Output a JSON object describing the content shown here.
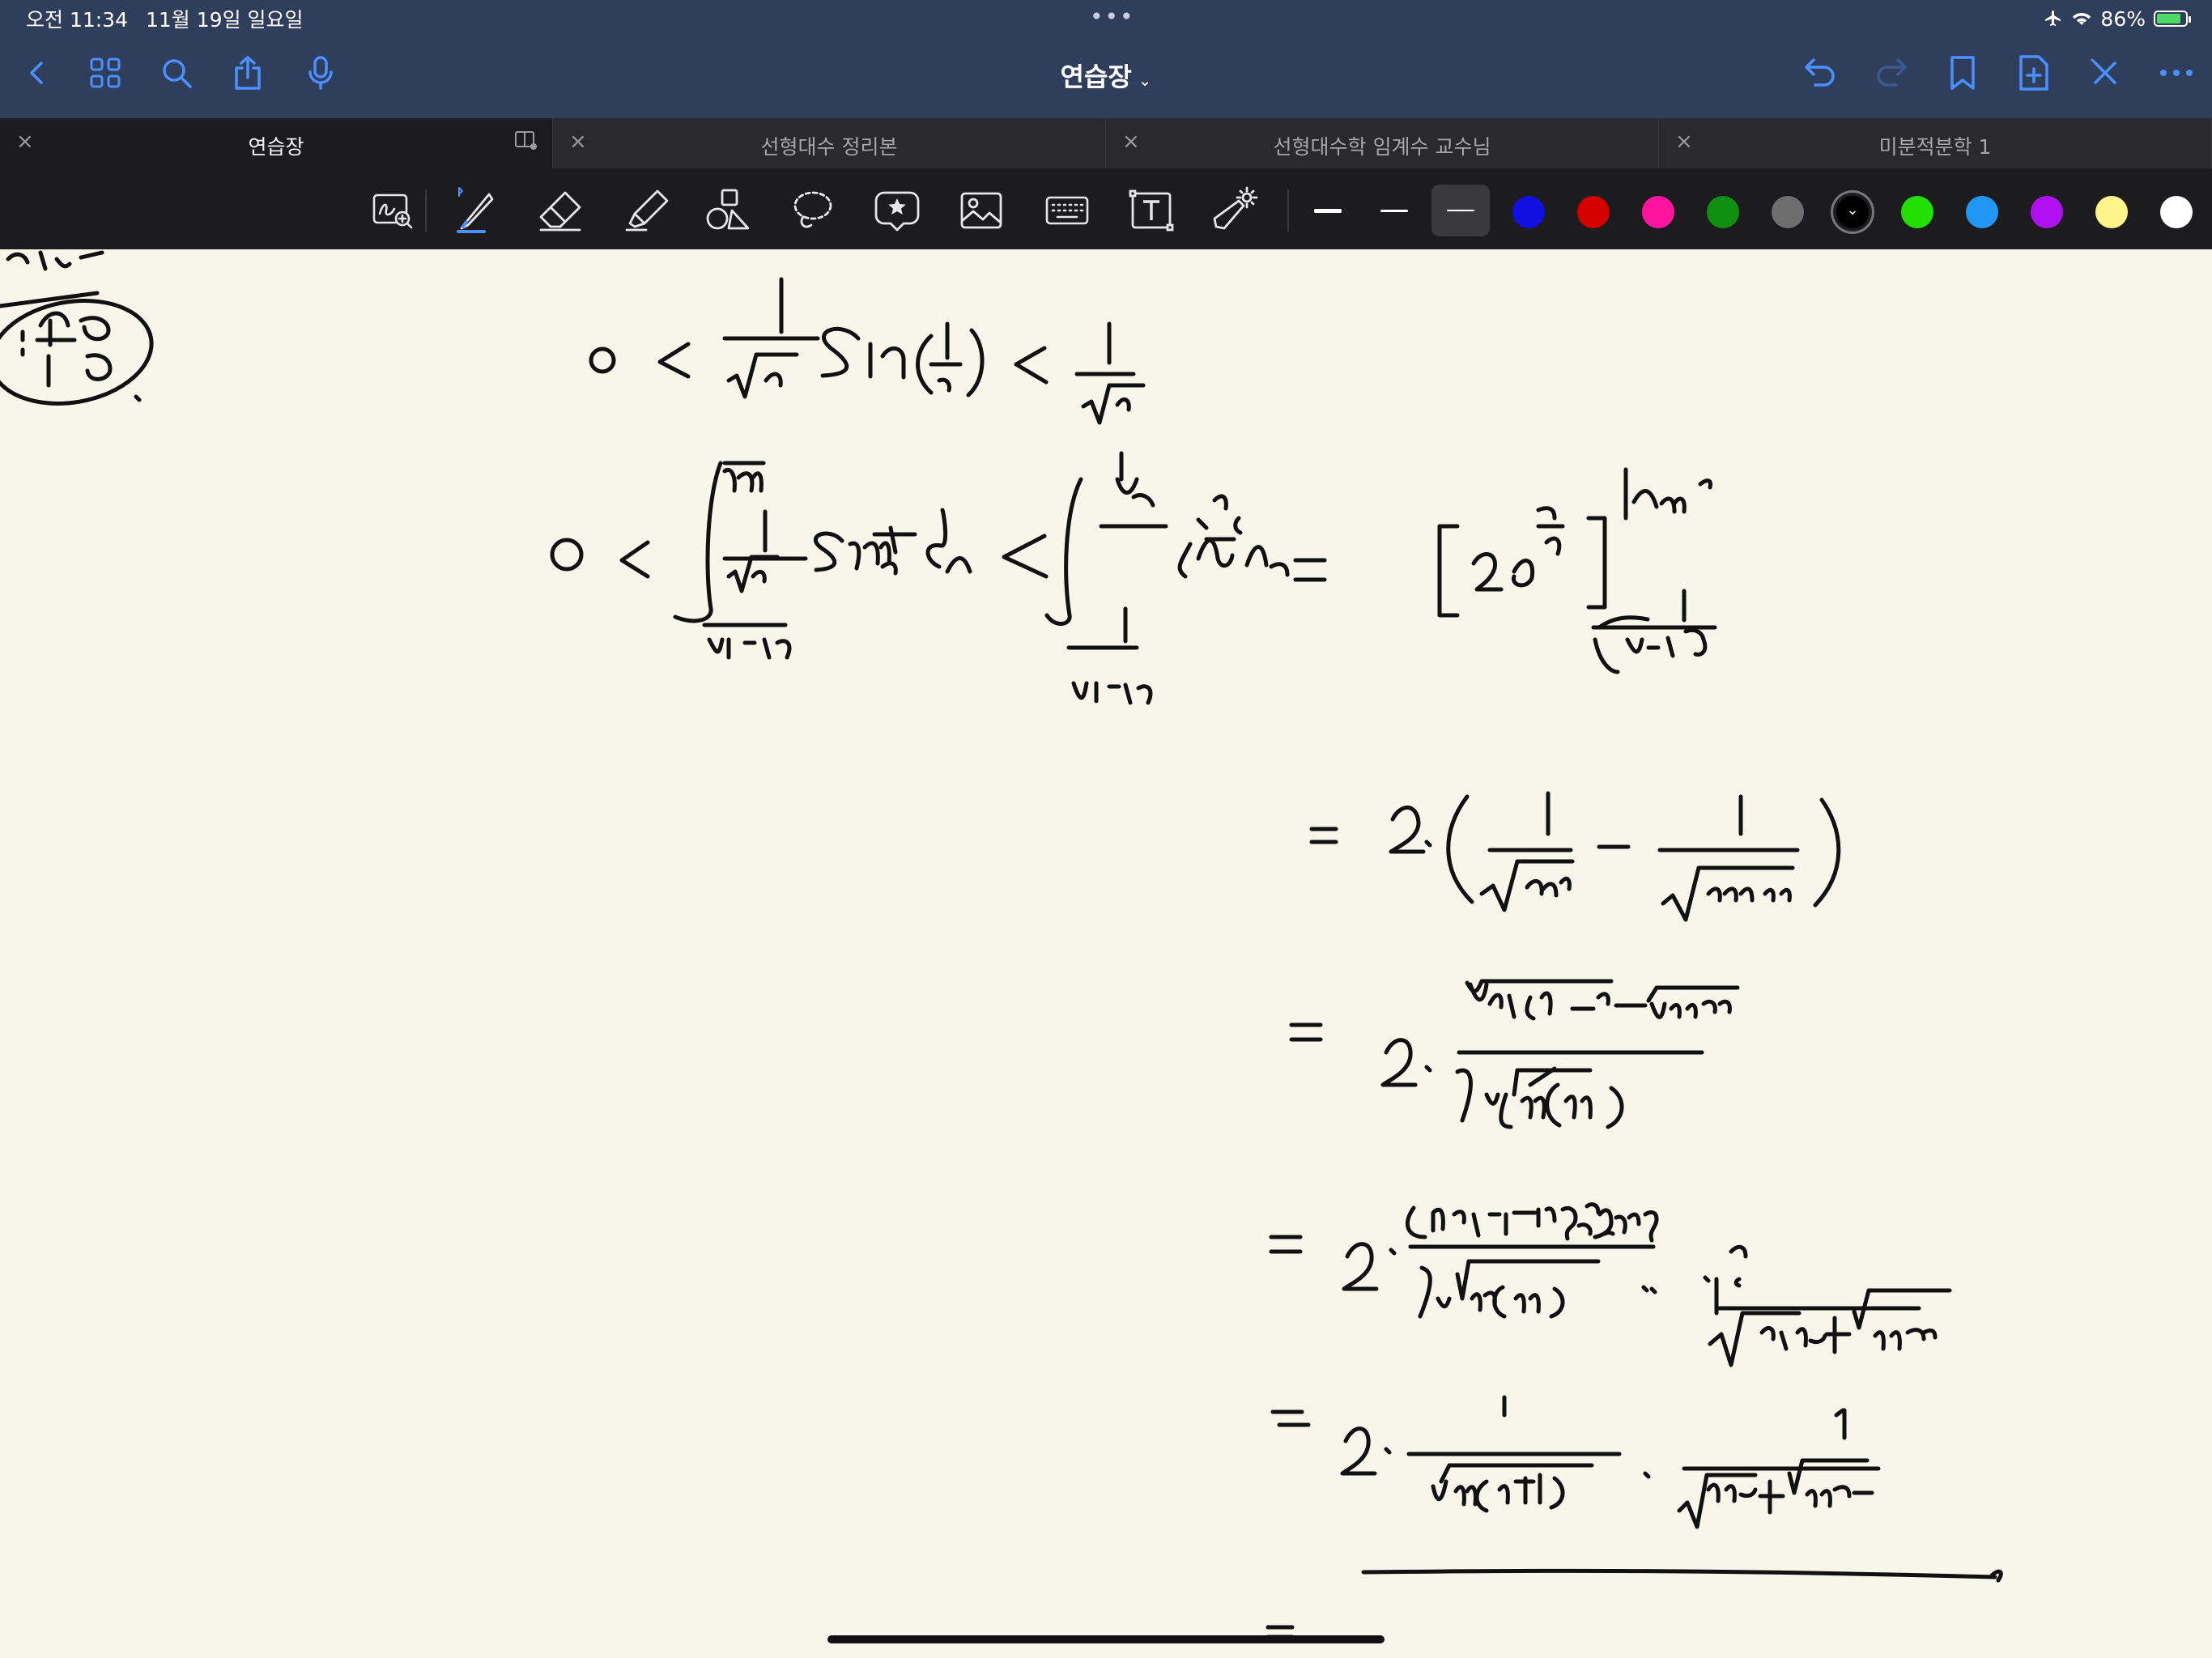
{
  "status_bar": {
    "time": "오전 11:34",
    "date": "11월 19일 일요일",
    "battery": "86%",
    "battery_level": 0.86,
    "icons": [
      "airplane-mode-icon",
      "wifi-icon",
      "battery-charging-icon"
    ]
  },
  "nav": {
    "title": "연습장",
    "left_icons": [
      "back-icon",
      "thumbnail-grid-icon",
      "search-icon",
      "share-icon",
      "microphone-icon"
    ],
    "right_icons": [
      "undo-icon",
      "redo-icon",
      "bookmark-icon",
      "add-page-icon",
      "close-icon",
      "more-icon"
    ]
  },
  "tabs": [
    {
      "label": "연습장",
      "active": true
    },
    {
      "label": "선형대수 정리본",
      "active": false
    },
    {
      "label": "선형대수학 임계수 교수님",
      "active": false
    },
    {
      "label": "미분적분학 1",
      "active": false
    }
  ],
  "tools": [
    "zoom-window",
    "pen",
    "eraser",
    "highlighter",
    "shapes",
    "lasso",
    "elements",
    "image",
    "keyboard",
    "text",
    "laser-pointer"
  ],
  "active_tool": "pen",
  "colors": {
    "topbar": "#2f3e5a",
    "accent": "#4a90ff",
    "swatches": [
      "#1010e0",
      "#d40000",
      "#ff14a0",
      "#109010",
      "#6e6e6e",
      "#000000",
      "#22e000",
      "#2196f3",
      "#b010f0",
      "#fff58a",
      "#ffffff"
    ],
    "selected_swatch": "#000000",
    "paper": "#f8f6ea"
  }
}
